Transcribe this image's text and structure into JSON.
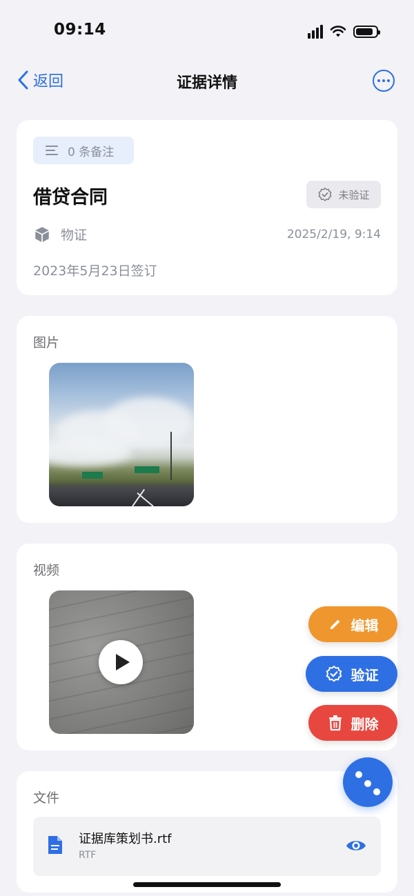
{
  "status_bar": {
    "time": "09:14"
  },
  "nav": {
    "back_label": "返回",
    "title": "证据详情"
  },
  "evidence": {
    "note_count_label": "0 条备注",
    "title": "借贷合同",
    "verify_status": "未验证",
    "category": "物证",
    "created_at": "2025/2/19, 9:14",
    "description": "2023年5月23日签订"
  },
  "images_section": {
    "label": "图片"
  },
  "video_section": {
    "label": "视频"
  },
  "files_section": {
    "label": "文件",
    "files": [
      {
        "name": "证据库策划书.rtf",
        "type": "RTF"
      }
    ]
  },
  "actions": {
    "edit_label": "编辑",
    "verify_label": "验证",
    "delete_label": "删除"
  },
  "colors": {
    "accent": "#2f6fe4",
    "edit": "#f0962e",
    "verify": "#2f6fe4",
    "delete": "#e8473f"
  }
}
